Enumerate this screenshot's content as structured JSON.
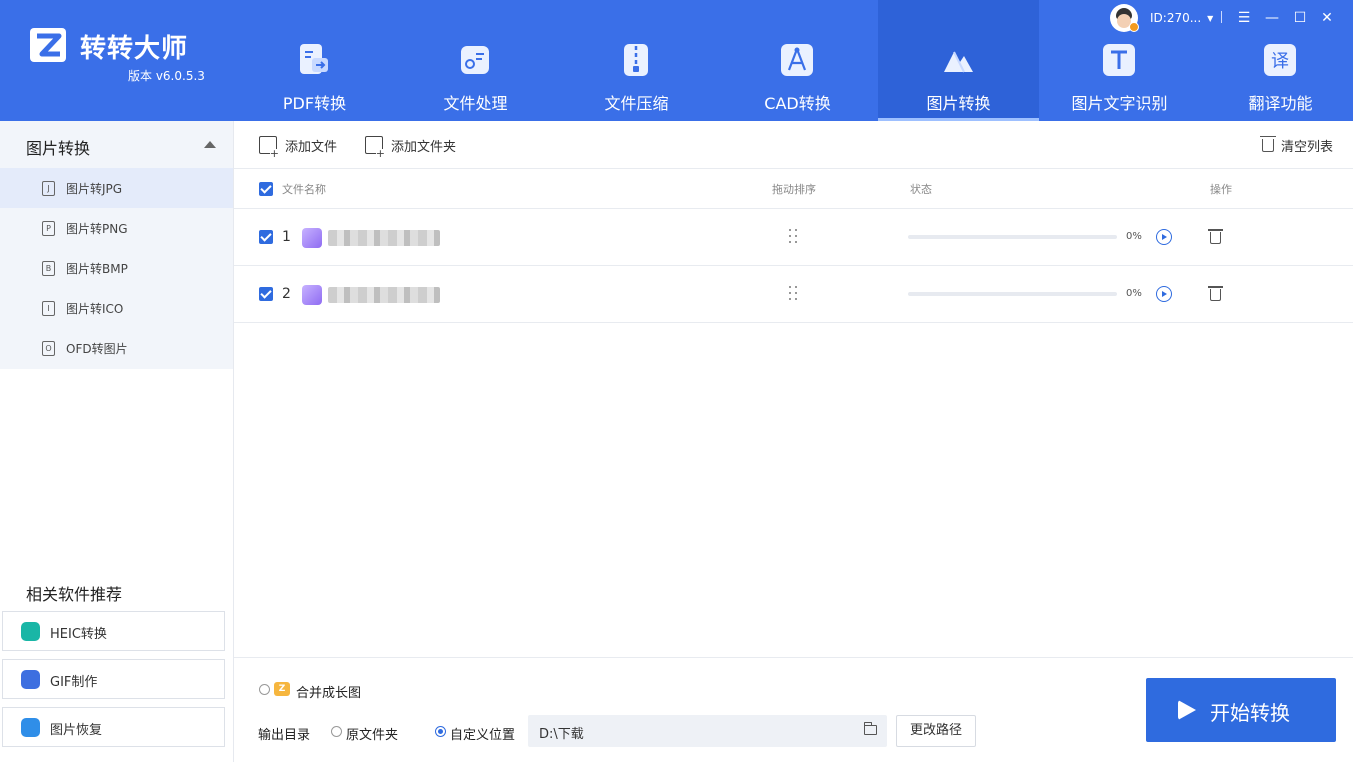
{
  "app": {
    "name": "转转大师",
    "version": "版本 v6.0.5.3",
    "user_id": "ID:270..."
  },
  "nav": {
    "tabs": [
      {
        "label": "PDF转换",
        "icon": "pdf-convert-icon"
      },
      {
        "label": "文件处理",
        "icon": "file-process-icon"
      },
      {
        "label": "文件压缩",
        "icon": "file-compress-icon"
      },
      {
        "label": "CAD转换",
        "icon": "cad-convert-icon"
      },
      {
        "label": "图片转换",
        "icon": "image-convert-icon",
        "active": true
      },
      {
        "label": "图片文字识别",
        "icon": "ocr-icon"
      },
      {
        "label": "翻译功能",
        "icon": "translate-icon"
      }
    ]
  },
  "window_controls": {
    "menu": "☰",
    "minimize": "—",
    "maximize": "☐",
    "close": "✕"
  },
  "sidebar": {
    "group_title": "图片转换",
    "items": [
      {
        "label": "图片转JPG",
        "glyph": "J",
        "active": true
      },
      {
        "label": "图片转PNG",
        "glyph": "P"
      },
      {
        "label": "图片转BMP",
        "glyph": "B"
      },
      {
        "label": "图片转ICO",
        "glyph": "I"
      },
      {
        "label": "OFD转图片",
        "glyph": "O"
      }
    ],
    "recommend_title": "相关软件推荐",
    "recommend": [
      {
        "label": "HEIC转换",
        "icon": "heic-icon",
        "color": "#19b6a6"
      },
      {
        "label": "GIF制作",
        "icon": "gif-icon",
        "color": "#3d6fe0"
      },
      {
        "label": "图片恢复",
        "icon": "photo-recovery-icon",
        "color": "#2f8ee8"
      }
    ]
  },
  "toolbar": {
    "add_file": "添加文件",
    "add_folder": "添加文件夹",
    "clear_list": "清空列表"
  },
  "table": {
    "columns": {
      "name": "文件名称",
      "sort": "拖动排序",
      "status": "状态",
      "action": "操作"
    },
    "rows": [
      {
        "index": "1",
        "progress_percent": 0,
        "progress_label": "0%",
        "checked": true
      },
      {
        "index": "2",
        "progress_percent": 0,
        "progress_label": "0%",
        "checked": true
      }
    ]
  },
  "bottom": {
    "merge_label": "合并成长图",
    "merge_badge": "Z",
    "output_dir_label": "输出目录",
    "option_original": "原文件夹",
    "option_custom": "自定义位置",
    "path_value": "D:\\下载",
    "change_path": "更改路径",
    "start_button": "开始转换"
  },
  "colors": {
    "header_bg": "#3a6fe8",
    "accent": "#2f6bdf",
    "sidebar_bg": "#f2f5fa"
  }
}
